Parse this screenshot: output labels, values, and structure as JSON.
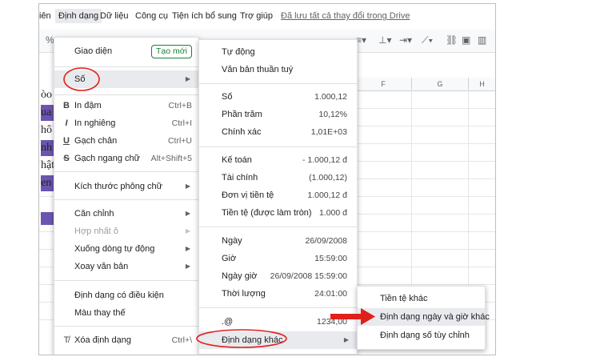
{
  "menubar": {
    "items": [
      "iên",
      "Định dạng",
      "Dữ liệu",
      "Công cụ",
      "Tiện ích bổ sung",
      "Trợ giúp"
    ],
    "saved": "Đã lưu tất cả thay đổi trong Drive"
  },
  "toolbar": {
    "percent": "%"
  },
  "columns": [
    "F",
    "G",
    "H"
  ],
  "cells": [
    "òo",
    "ua",
    "hô",
    "nh",
    "hật",
    "en"
  ],
  "format_menu": {
    "theme": "Giao diện",
    "new_badge": "Tạo mới",
    "number": "Số",
    "bold": "In đậm",
    "bold_sc": "Ctrl+B",
    "italic": "In nghiêng",
    "italic_sc": "Ctrl+I",
    "underline": "Gạch chân",
    "underline_sc": "Ctrl+U",
    "strike": "Gạch ngang chữ",
    "strike_sc": "Alt+Shift+5",
    "font_size": "Kích thước phông chữ",
    "align": "Căn chỉnh",
    "merge": "Hợp nhất ô",
    "wrap": "Xuống dòng tự động",
    "rotate": "Xoay văn bản",
    "conditional": "Định dạng có điều kiện",
    "alternating": "Màu thay thế",
    "clear": "Xóa định dạng",
    "clear_sc": "Ctrl+\\"
  },
  "number_menu": {
    "auto": "Tự động",
    "plain": "Văn bản thuần tuý",
    "number": "Số",
    "number_val": "1.000,12",
    "percent": "Phần trăm",
    "percent_val": "10,12%",
    "scientific": "Chính xác",
    "scientific_val": "1,01E+03",
    "accounting": "Kế toán",
    "accounting_val": "- 1.000,12 đ",
    "financial": "Tài chính",
    "financial_val": "(1.000,12)",
    "currency": "Đơn vị tiền tệ",
    "currency_val": "1.000,12 đ",
    "currency_rounded": "Tiền tệ (được làm tròn)",
    "currency_rounded_val": "1.000 đ",
    "date": "Ngày",
    "date_val": "26/09/2008",
    "time": "Giờ",
    "time_val": "15:59:00",
    "datetime": "Ngày giờ",
    "datetime_val": "26/09/2008 15:59:00",
    "duration": "Thời lượng",
    "duration_val": "24:01:00",
    "custom_sym": ".@",
    "custom_val": "1234,00",
    "more": "Định dạng khác"
  },
  "more_menu": {
    "more_currencies": "Tiền tệ khác",
    "date_time": "Định dạng ngày và giờ khác",
    "custom": "Định dạng số tùy chỉnh"
  },
  "colors": {
    "highlight": "#e8eaed",
    "annotation": "#e0201b",
    "purple_fill": "#6c55b0",
    "badge": "#188038"
  }
}
